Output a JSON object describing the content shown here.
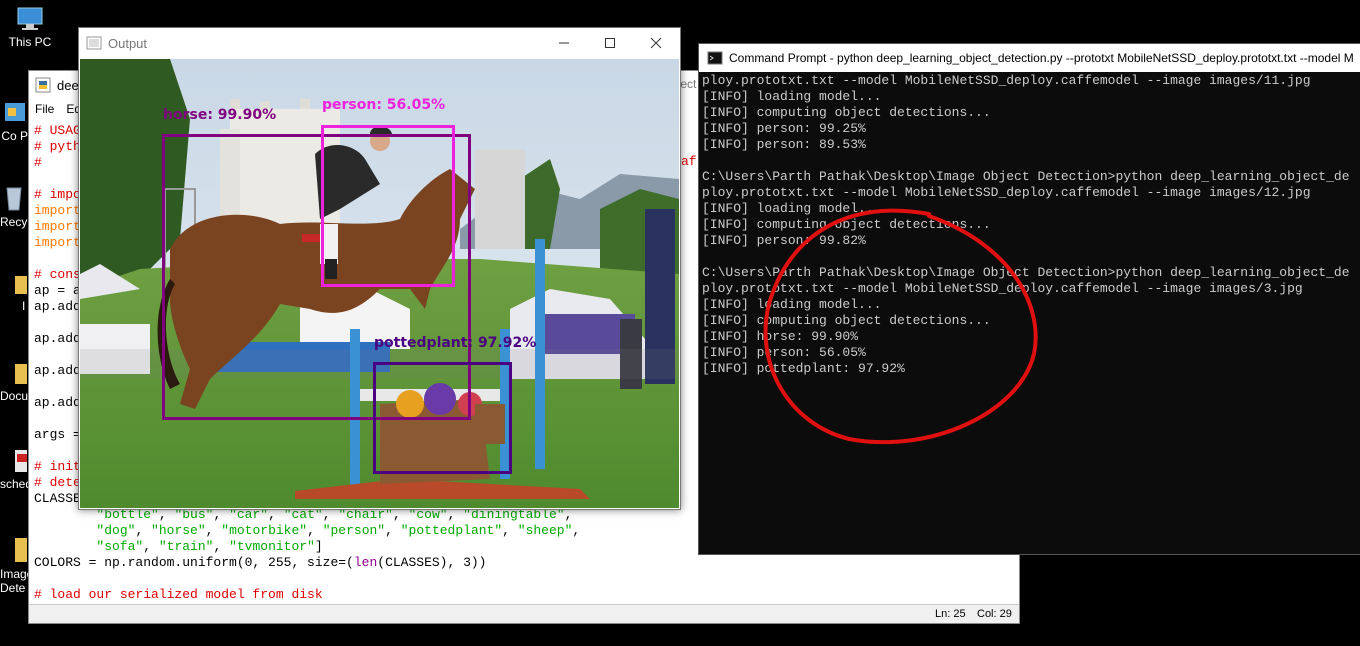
{
  "desktop": {
    "icons": [
      {
        "label": "This PC",
        "icon": "computer-icon"
      },
      {
        "label": "Co Pa",
        "icon": "control-panel-icon"
      },
      {
        "label": "Recy",
        "icon": "recycle-bin-icon"
      },
      {
        "label": "I",
        "icon": "folder-icon"
      },
      {
        "label": "Docu",
        "icon": "folder-icon"
      },
      {
        "label": "sched",
        "icon": "pdf-icon"
      },
      {
        "label": "Image Dete",
        "icon": "folder-icon"
      }
    ]
  },
  "editor": {
    "title": "dee",
    "menu": [
      "File",
      "Ed"
    ],
    "lines": [
      [
        {
          "t": "# USAG",
          "c": "com"
        }
      ],
      [
        {
          "t": "# pyth",
          "c": "com"
        }
      ],
      [
        {
          "t": "#",
          "c": "com"
        }
      ],
      [
        {
          "t": "",
          "c": "def"
        }
      ],
      [
        {
          "t": "# impo",
          "c": "com"
        }
      ],
      [
        {
          "t": "import",
          "c": "kw"
        }
      ],
      [
        {
          "t": "import",
          "c": "kw"
        }
      ],
      [
        {
          "t": "import",
          "c": "kw"
        }
      ],
      [
        {
          "t": "",
          "c": "def"
        }
      ],
      [
        {
          "t": "# cons",
          "c": "com"
        }
      ],
      [
        {
          "t": "ap = a",
          "c": "def"
        }
      ],
      [
        {
          "t": "ap.add",
          "c": "def"
        }
      ],
      [
        {
          "t": "",
          "c": "def"
        }
      ],
      [
        {
          "t": "ap.add",
          "c": "def"
        }
      ],
      [
        {
          "t": "",
          "c": "def"
        }
      ],
      [
        {
          "t": "ap.add",
          "c": "def"
        }
      ],
      [
        {
          "t": "",
          "c": "def"
        }
      ],
      [
        {
          "t": "ap.add",
          "c": "def"
        }
      ],
      [
        {
          "t": "",
          "c": "def"
        }
      ],
      [
        {
          "t": "args =",
          "c": "def"
        }
      ],
      [
        {
          "t": "",
          "c": "def"
        }
      ],
      [
        {
          "t": "# init",
          "c": "com"
        }
      ],
      [
        {
          "t": "# dete",
          "c": "com"
        }
      ],
      [
        {
          "t": "CLASSE",
          "c": "def"
        }
      ],
      [
        {
          "t": "        ",
          "c": "def"
        },
        {
          "t": "\"bottle\"",
          "c": "str"
        },
        {
          "t": ", ",
          "c": "def"
        },
        {
          "t": "\"bus\"",
          "c": "str"
        },
        {
          "t": ", ",
          "c": "def"
        },
        {
          "t": "\"car\"",
          "c": "str"
        },
        {
          "t": ", ",
          "c": "def"
        },
        {
          "t": "\"cat\"",
          "c": "str"
        },
        {
          "t": ", ",
          "c": "def"
        },
        {
          "t": "\"chair\"",
          "c": "str"
        },
        {
          "t": ", ",
          "c": "def"
        },
        {
          "t": "\"cow\"",
          "c": "str"
        },
        {
          "t": ", ",
          "c": "def"
        },
        {
          "t": "\"diningtable\"",
          "c": "str"
        },
        {
          "t": ",",
          "c": "def"
        }
      ],
      [
        {
          "t": "        ",
          "c": "def"
        },
        {
          "t": "\"dog\"",
          "c": "str"
        },
        {
          "t": ", ",
          "c": "def"
        },
        {
          "t": "\"horse\"",
          "c": "str"
        },
        {
          "t": ", ",
          "c": "def"
        },
        {
          "t": "\"motorbike\"",
          "c": "str"
        },
        {
          "t": ", ",
          "c": "def"
        },
        {
          "t": "\"person\"",
          "c": "str"
        },
        {
          "t": ", ",
          "c": "def"
        },
        {
          "t": "\"pottedplant\"",
          "c": "str"
        },
        {
          "t": ", ",
          "c": "def"
        },
        {
          "t": "\"sheep\"",
          "c": "str"
        },
        {
          "t": ",",
          "c": "def"
        }
      ],
      [
        {
          "t": "        ",
          "c": "def"
        },
        {
          "t": "\"sofa\"",
          "c": "str"
        },
        {
          "t": ", ",
          "c": "def"
        },
        {
          "t": "\"train\"",
          "c": "str"
        },
        {
          "t": ", ",
          "c": "def"
        },
        {
          "t": "\"tvmonitor\"",
          "c": "str"
        },
        {
          "t": "]",
          "c": "def"
        }
      ],
      [
        {
          "t": "COLORS = np.random.uniform(0, 255, size=(",
          "c": "def"
        },
        {
          "t": "len",
          "c": "bi"
        },
        {
          "t": "(CLASSES), 3))",
          "c": "def"
        }
      ],
      [
        {
          "t": "",
          "c": "def"
        }
      ],
      [
        {
          "t": "# load our serialized model from disk",
          "c": "com"
        }
      ]
    ],
    "status": {
      "ln": "Ln: 25",
      "col": "Col: 29"
    },
    "side_fragments": {
      "top": "tect",
      "mid": "af"
    }
  },
  "output_window": {
    "title": "Output",
    "detections": [
      {
        "label": "horse: 99.90%",
        "color": "#800080"
      },
      {
        "label": "person: 56.05%",
        "color": "#ee22dd"
      },
      {
        "label": "pottedplant: 97.92%",
        "color": "#4b0082"
      }
    ]
  },
  "cmd": {
    "title": "Command Prompt - python  deep_learning_object_detection.py --prototxt MobileNetSSD_deploy.prototxt.txt --model M",
    "lines": [
      "ploy.prototxt.txt --model MobileNetSSD_deploy.caffemodel --image images/11.jpg",
      "[INFO] loading model...",
      "[INFO] computing object detections...",
      "[INFO] person: 99.25%",
      "[INFO] person: 89.53%",
      "",
      "C:\\Users\\Parth Pathak\\Desktop\\Image Object Detection>python deep_learning_object_de",
      "ploy.prototxt.txt --model MobileNetSSD_deploy.caffemodel --image images/12.jpg",
      "[INFO] loading model...",
      "[INFO] computing object detections...",
      "[INFO] person: 99.82%",
      "",
      "C:\\Users\\Parth Pathak\\Desktop\\Image Object Detection>python deep_learning_object_de",
      "ploy.prototxt.txt --model MobileNetSSD_deploy.caffemodel --image images/3.jpg",
      "[INFO] loading model...",
      "[INFO] computing object detections...",
      "[INFO] horse: 99.90%",
      "[INFO] person: 56.05%",
      "[INFO] pottedplant: 97.92%"
    ]
  },
  "annotation_color": "#e01010"
}
